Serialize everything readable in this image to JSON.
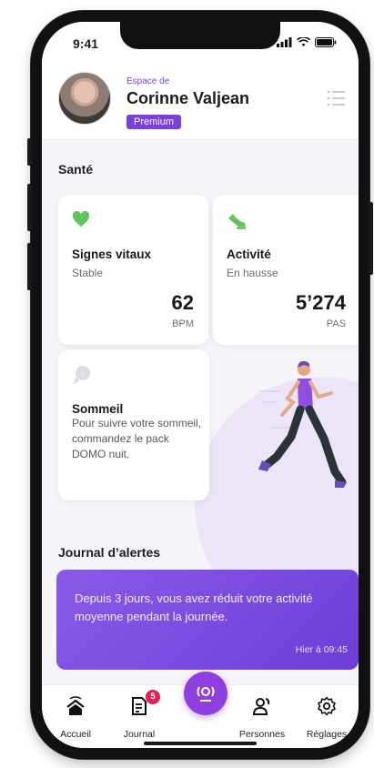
{
  "status_bar": {
    "time": "9:41"
  },
  "header": {
    "space_label": "Espace de",
    "user_name": "Corinne Valjean",
    "badge": "Premium"
  },
  "health": {
    "section_title": "Santé",
    "vitals": {
      "title": "Signes vitaux",
      "status": "Stable",
      "value": "62",
      "unit": "BPM",
      "icon": "heart-icon",
      "icon_color": "#62c45b"
    },
    "activity": {
      "title": "Activité",
      "status": "En hausse",
      "value": "5’274",
      "unit": "PAS",
      "icon": "sneaker-icon",
      "icon_color": "#62c45b"
    },
    "sleep": {
      "title": "Sommeil",
      "description": "Pour suivre votre sommeil, commandez le pack DOMO nuit.",
      "icon": "sleep-cloud-icon"
    }
  },
  "alerts": {
    "section_title": "Journal d’alertes",
    "items": [
      {
        "text": "Depuis 3 jours, vous avez réduit votre activité moyenne pendant la journée.",
        "time": "Hier à 09:45"
      }
    ]
  },
  "tabbar": {
    "tabs": [
      {
        "label": "Accueil",
        "icon": "home-icon"
      },
      {
        "label": "Journal",
        "icon": "journal-icon",
        "badge": "5"
      },
      {
        "label": "",
        "icon": "alarm-broadcast-icon"
      },
      {
        "label": "Personnes",
        "icon": "people-icon"
      },
      {
        "label": "Réglages",
        "icon": "gear-icon"
      }
    ]
  },
  "colors": {
    "accent": "#7b3fe0",
    "alert_gradient_start": "#8a5ae8",
    "badge_red": "#e2205b"
  }
}
